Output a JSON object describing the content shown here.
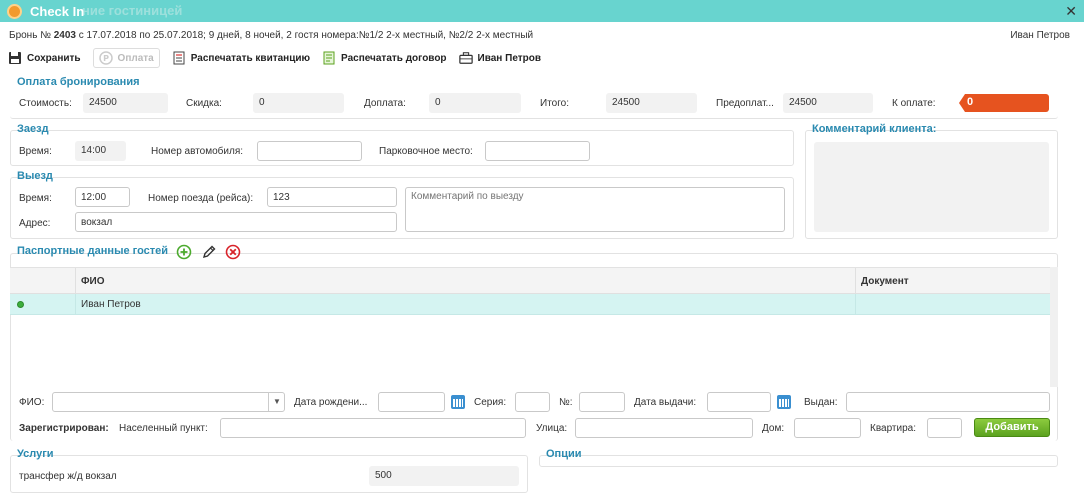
{
  "window": {
    "ghost_title": "ние гостиницей",
    "title": "Check In",
    "close": "✕"
  },
  "booking": {
    "number_label": "Бронь №",
    "number": "2403",
    "details": "с 17.07.2018 по 25.07.2018; 9 дней, 8 ночей, 2 гостя номера:№1/2 2-х местный, №2/2 2-х местный",
    "user": "Иван Петров"
  },
  "toolbar": {
    "save": "Сохранить",
    "payment": "Оплата",
    "print_receipt": "Распечатать квитанцию",
    "print_contract": "Распечатать договор",
    "guest": "Иван Петров"
  },
  "payment": {
    "title": "Оплата бронирования",
    "cost_label": "Стоимость:",
    "cost": "24500",
    "discount_label": "Скидка:",
    "discount": "0",
    "extra_label": "Доплата:",
    "extra": "0",
    "total_label": "Итого:",
    "total": "24500",
    "prepaid_label": "Предоплат...",
    "prepaid": "24500",
    "to_pay_label": "К оплате:",
    "to_pay": "0"
  },
  "arrival": {
    "title": "Заезд",
    "time_label": "Время:",
    "time": "14:00",
    "car_label": "Номер автомобиля:",
    "car": "",
    "parking_label": "Парковочное место:",
    "parking": ""
  },
  "departure": {
    "title": "Выезд",
    "time_label": "Время:",
    "time": "12:00",
    "train_label": "Номер поезда (рейса):",
    "train": "123",
    "address_label": "Адрес:",
    "address": "вокзал",
    "comment_placeholder": "Комментарий по выезду"
  },
  "client_comment": {
    "title": "Комментарий клиента:"
  },
  "passport": {
    "title": "Паспортные данные гостей",
    "columns": [
      "ФИО",
      "Документ"
    ],
    "rows": [
      {
        "name": "Иван Петров",
        "document": ""
      }
    ]
  },
  "guest_form": {
    "fio_label": "ФИО:",
    "birth_label": "Дата рождени...",
    "series_label": "Серия:",
    "no_label": "№:",
    "issue_date_label": "Дата выдачи:",
    "issued_label": "Выдан:",
    "registered_label": "Зарегистрирован:",
    "city_label": "Населенный пункт:",
    "street_label": "Улица:",
    "house_label": "Дом:",
    "flat_label": "Квартира:",
    "add_button": "Добавить"
  },
  "services": {
    "title": "Услуги",
    "items": [
      {
        "name": "трансфер ж/д вокзал",
        "price": "500"
      }
    ]
  },
  "options": {
    "title": "Опции"
  },
  "colors": {
    "accent": "#2a8ab0",
    "titlebar": "#68d4cf",
    "to_pay": "#e6531f",
    "add": "#5ca21f"
  }
}
